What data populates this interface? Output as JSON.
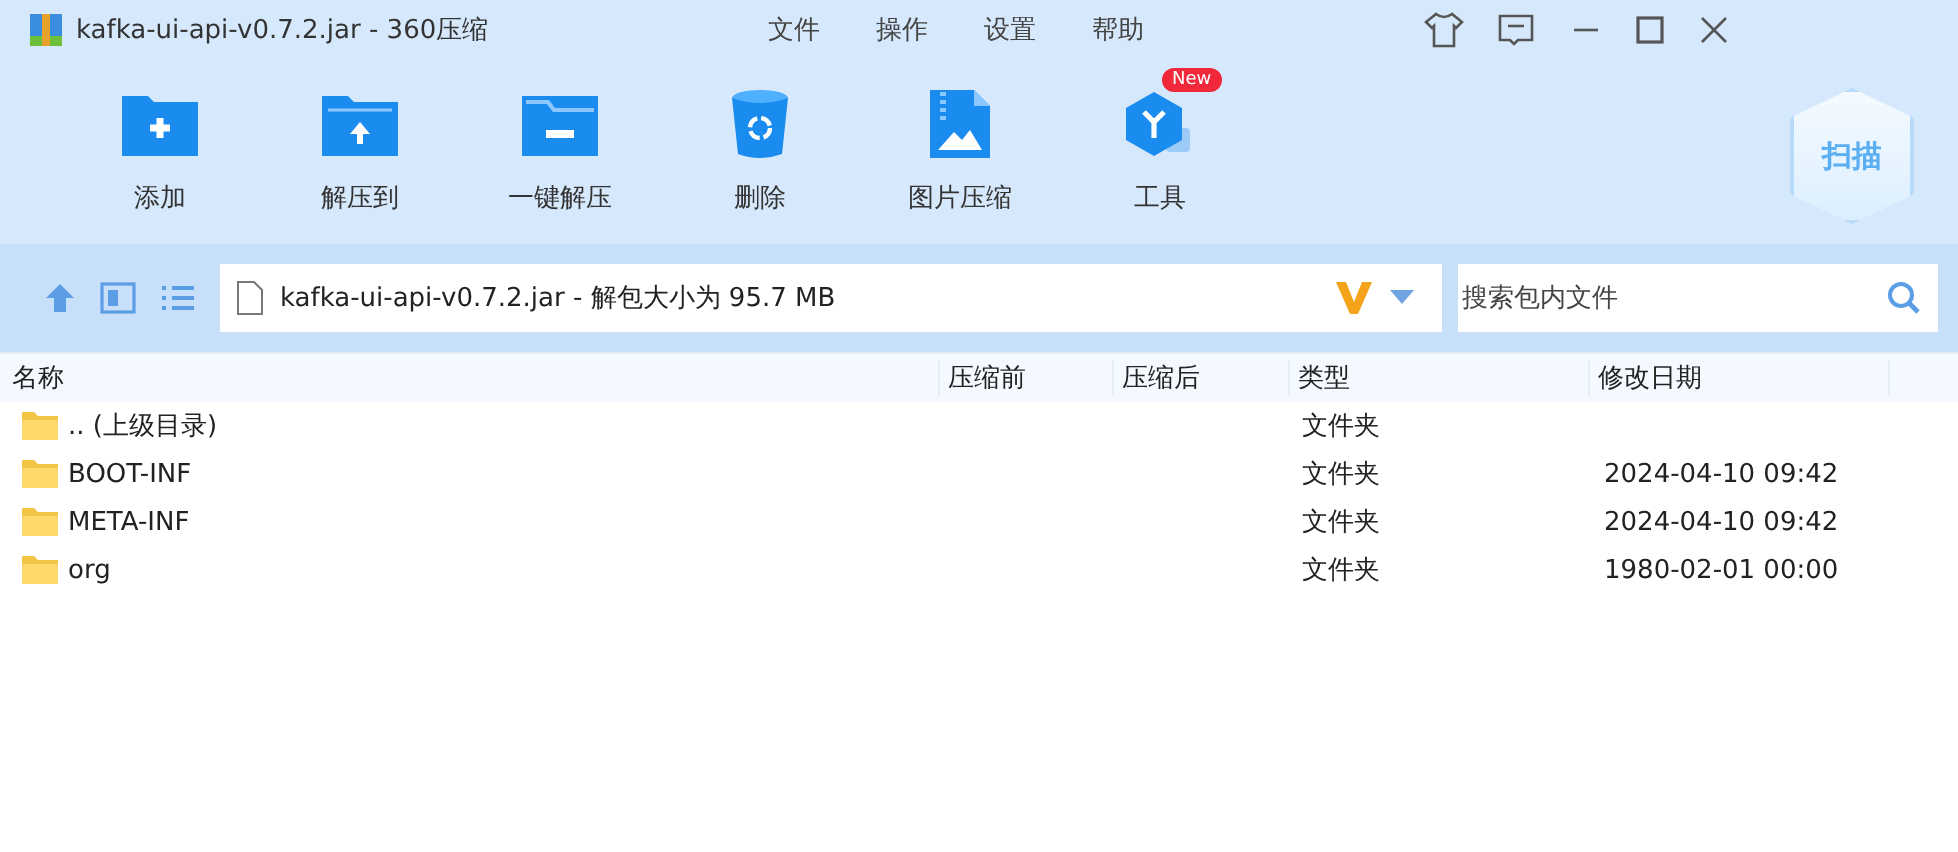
{
  "window": {
    "title": "kafka-ui-api-v0.7.2.jar - 360压缩"
  },
  "menu": [
    "文件",
    "操作",
    "设置",
    "帮助"
  ],
  "toolbar": [
    {
      "kind": "add",
      "label": "添加"
    },
    {
      "kind": "extract",
      "label": "解压到"
    },
    {
      "kind": "oneclick",
      "label": "一键解压"
    },
    {
      "kind": "delete",
      "label": "删除"
    },
    {
      "kind": "image",
      "label": "图片压缩"
    },
    {
      "kind": "tools",
      "label": "工具",
      "badge": "New"
    }
  ],
  "scan_button": {
    "label": "扫描"
  },
  "address": {
    "value": "kafka-ui-api-v0.7.2.jar - 解包大小为 95.7 MB"
  },
  "search": {
    "placeholder": "搜索包内文件"
  },
  "table": {
    "columns": [
      "名称",
      "压缩前",
      "压缩后",
      "类型",
      "修改日期"
    ],
    "rows": [
      {
        "name": ".. (上级目录)",
        "type": "文件夹",
        "modified": ""
      },
      {
        "name": "BOOT-INF",
        "type": "文件夹",
        "modified": "2024-04-10 09:42"
      },
      {
        "name": "META-INF",
        "type": "文件夹",
        "modified": "2024-04-10 09:42"
      },
      {
        "name": "org",
        "type": "文件夹",
        "modified": "1980-02-01 00:00"
      }
    ]
  }
}
